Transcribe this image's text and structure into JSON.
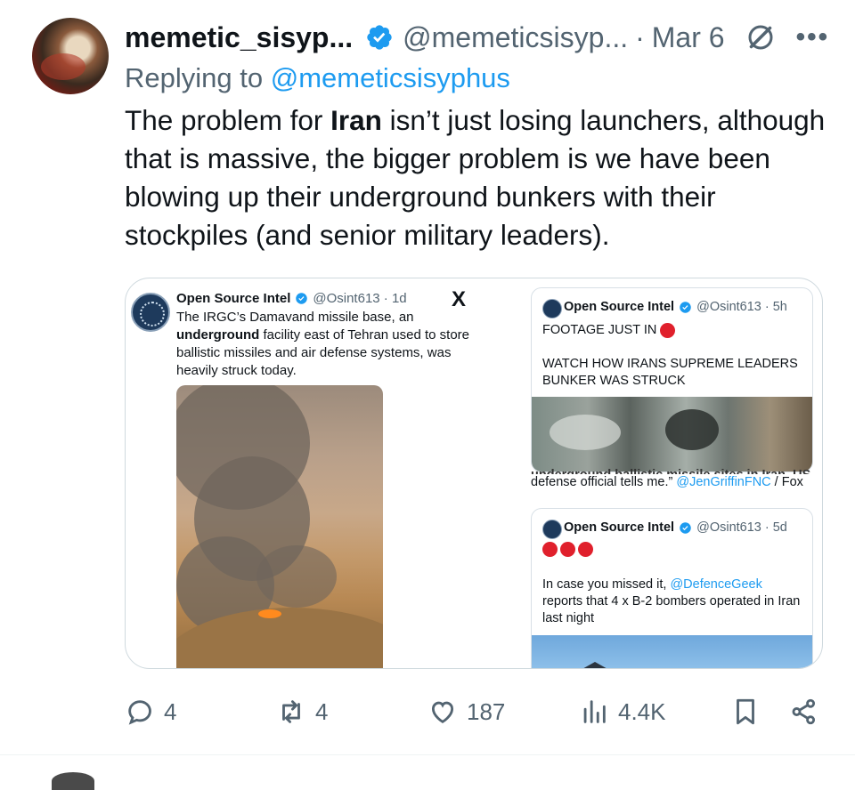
{
  "tweet": {
    "author_name": "memetic_sisyp...",
    "handle": "@memeticsisyp...",
    "separator": "·",
    "date": "Mar 6",
    "reply_prefix": "Replying to",
    "reply_to": "@memeticsisyphus",
    "text_before": "The problem for ",
    "text_bold": "Iran",
    "text_after": " isn’t just losing launchers, although that is massive, the bigger problem is we have been blowing up their underground bunkers with their stockpiles (and senior military leaders)."
  },
  "embedded_left": {
    "name": "Open Source Intel",
    "handle_time": "@Osint613 · 1d",
    "x_logo": "X",
    "text_1": "The IRGC’s Damavand missile base, an ",
    "text_bold": "underground",
    "text_2": " facility east of Tehran used to store ballistic missiles and air defense systems, was heavily struck today."
  },
  "embedded_top_right": {
    "name": "Open Source Intel",
    "handle_time": "@Osint613 · 5h",
    "line1": "FOOTAGE JUST IN",
    "line2": "WATCH HOW IRANS SUPREME LEADERS BUNKER WAS STRUCK"
  },
  "fragment": {
    "cut_text": "underground ballistic missile sites in Iran. US",
    "text": "defense official tells me.” ",
    "mention": "@JenGriffinFNC",
    "tail": " / Fox"
  },
  "embedded_bottom_right": {
    "name": "Open Source Intel",
    "handle_time": "@Osint613 · 5d",
    "text_1": "In case you missed it, ",
    "mention": "@DefenceGeek",
    "text_2": " reports that 4 x B-2 bombers operated in Iran last night"
  },
  "actions": {
    "replies": "4",
    "reposts": "4",
    "likes": "187",
    "views": "4.4K"
  },
  "colors": {
    "accent": "#1d9bf0",
    "muted": "#536471",
    "text": "#0f1419"
  }
}
